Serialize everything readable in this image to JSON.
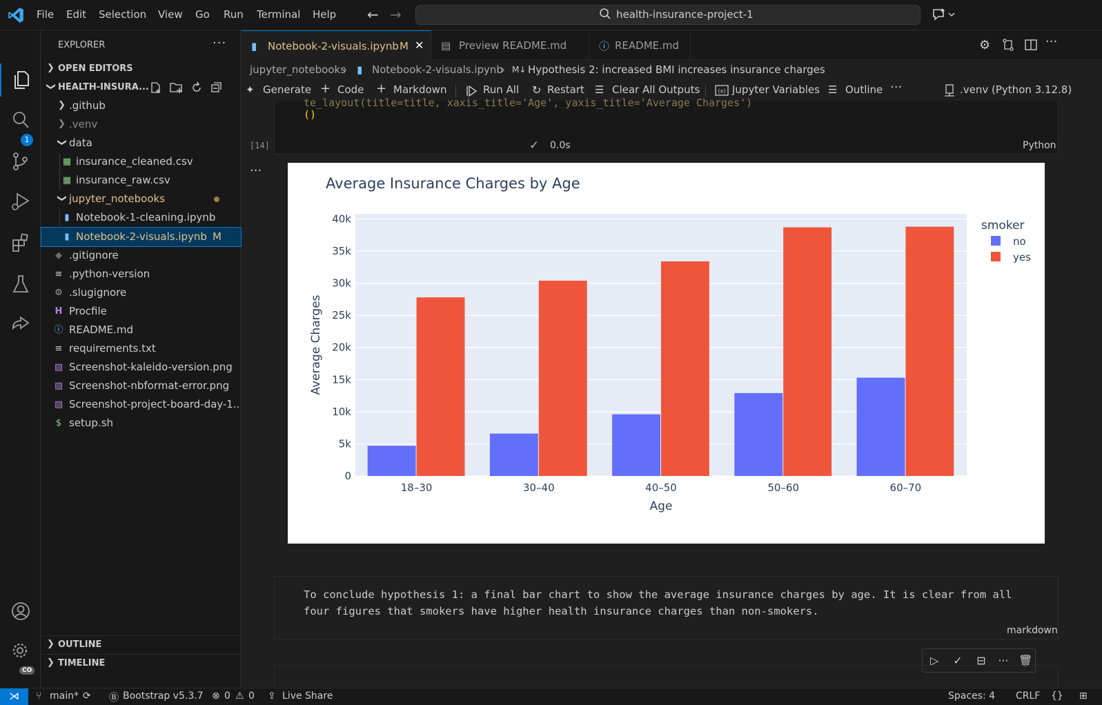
{
  "titlebar": {
    "menu": [
      "File",
      "Edit",
      "Selection",
      "View",
      "Go",
      "Run",
      "Terminal",
      "Help"
    ],
    "search_text": "health-insurance-project-1"
  },
  "activity": {
    "scm_badge": "1",
    "settings_badge": "CO"
  },
  "sidebar": {
    "title": "EXPLORER",
    "open_editors": "OPEN EDITORS",
    "project": "HEALTH-INSURA...",
    "outline": "OUTLINE",
    "timeline": "TIMELINE",
    "tree": [
      {
        "label": ".github",
        "type": "folder",
        "collapsed": true
      },
      {
        "label": ".venv",
        "type": "folder",
        "collapsed": true
      },
      {
        "label": "data",
        "type": "folder",
        "collapsed": false
      },
      {
        "label": "insurance_cleaned.csv",
        "type": "csv"
      },
      {
        "label": "insurance_raw.csv",
        "type": "csv"
      },
      {
        "label": "jupyter_notebooks",
        "type": "folder",
        "collapsed": false
      },
      {
        "label": "Notebook-1-cleaning.ipynb",
        "type": "notebook"
      },
      {
        "label": "Notebook-2-visuals.ipynb",
        "type": "notebook",
        "badge": "M"
      },
      {
        "label": ".gitignore",
        "type": "git"
      },
      {
        "label": ".python-version",
        "type": "text"
      },
      {
        "label": ".slugignore",
        "type": "gear"
      },
      {
        "label": "Procfile",
        "type": "procfile"
      },
      {
        "label": "README.md",
        "type": "info"
      },
      {
        "label": "requirements.txt",
        "type": "text"
      },
      {
        "label": "Screenshot-kaleido-version.png",
        "type": "image"
      },
      {
        "label": "Screenshot-nbformat-error.png",
        "type": "image"
      },
      {
        "label": "Screenshot-project-board-day-1...",
        "type": "image"
      },
      {
        "label": "setup.sh",
        "type": "shell"
      }
    ]
  },
  "tabs": [
    {
      "label": "Notebook-2-visuals.ipynb",
      "badge": "M"
    },
    {
      "label": "Preview README.md"
    },
    {
      "label": "README.md"
    }
  ],
  "breadcrumb": {
    "folder": "jupyter_notebooks",
    "file": "Notebook-2-visuals.ipynb",
    "md_badge": "M↓",
    "section": "Hypothesis 2: increased BMI increases insurance charges"
  },
  "toolbar": {
    "generate": "Generate",
    "code": "Code",
    "markdown": "Markdown",
    "run_all": "Run All",
    "restart": "Restart",
    "clear_outputs": "Clear All Outputs",
    "variables": "Jupyter Variables",
    "outline": "Outline",
    "kernel": ".venv (Python 3.12.8)"
  },
  "code_cell": {
    "line1": "te_layout(title=title, xaxis_title='Age', yaxis_title='Average Charges')",
    "line2": "()",
    "exec_count": "[14]",
    "exec_time": "0.0s",
    "language": "Python"
  },
  "chart_data": {
    "type": "bar",
    "title": "Average Insurance Charges by Age",
    "xlabel": "Age",
    "ylabel": "Average Charges",
    "categories": [
      "18–30",
      "30–40",
      "40–50",
      "50–60",
      "60–70"
    ],
    "ylim": [
      0,
      40800
    ],
    "yticks": [
      "0",
      "5k",
      "10k",
      "15k",
      "20k",
      "25k",
      "30k",
      "35k",
      "40k"
    ],
    "legend_title": "smoker",
    "legend_position": "top-right",
    "grid": true,
    "series": [
      {
        "name": "no",
        "color": "#636efa",
        "values": [
          4700,
          6600,
          9600,
          12900,
          15300
        ]
      },
      {
        "name": "yes",
        "color": "#ef553b",
        "values": [
          27800,
          30400,
          33400,
          38700,
          38800
        ]
      }
    ]
  },
  "markdown_cell": {
    "text": "To conclude hypothesis 1: a final bar chart to show the average insurance charges by age. It is clear from all four figures that smokers have higher health insurance charges than non-smokers.",
    "language": "markdown"
  },
  "statusbar": {
    "branch": "main*",
    "bootstrap": "Bootstrap v5.3.7",
    "errors": "0",
    "warnings": "0",
    "live_share": "Live Share",
    "spaces": "Spaces: 4",
    "eol": "CRLF",
    "braces": "{}"
  }
}
